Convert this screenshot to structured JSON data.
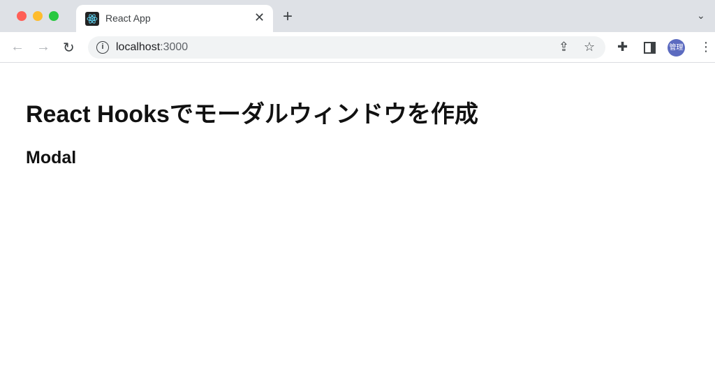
{
  "browser": {
    "tab": {
      "title": "React App",
      "favicon": "react-logo-icon"
    },
    "address": {
      "host": "localhost",
      "port": ":3000"
    },
    "profile": {
      "label": "管理",
      "color": "#5c6bc0"
    },
    "traffic_lights": [
      "#ff5f57",
      "#febc2e",
      "#28c840"
    ]
  },
  "page": {
    "title": "React Hooksでモーダルウィンドウを作成",
    "subtitle": "Modal"
  }
}
